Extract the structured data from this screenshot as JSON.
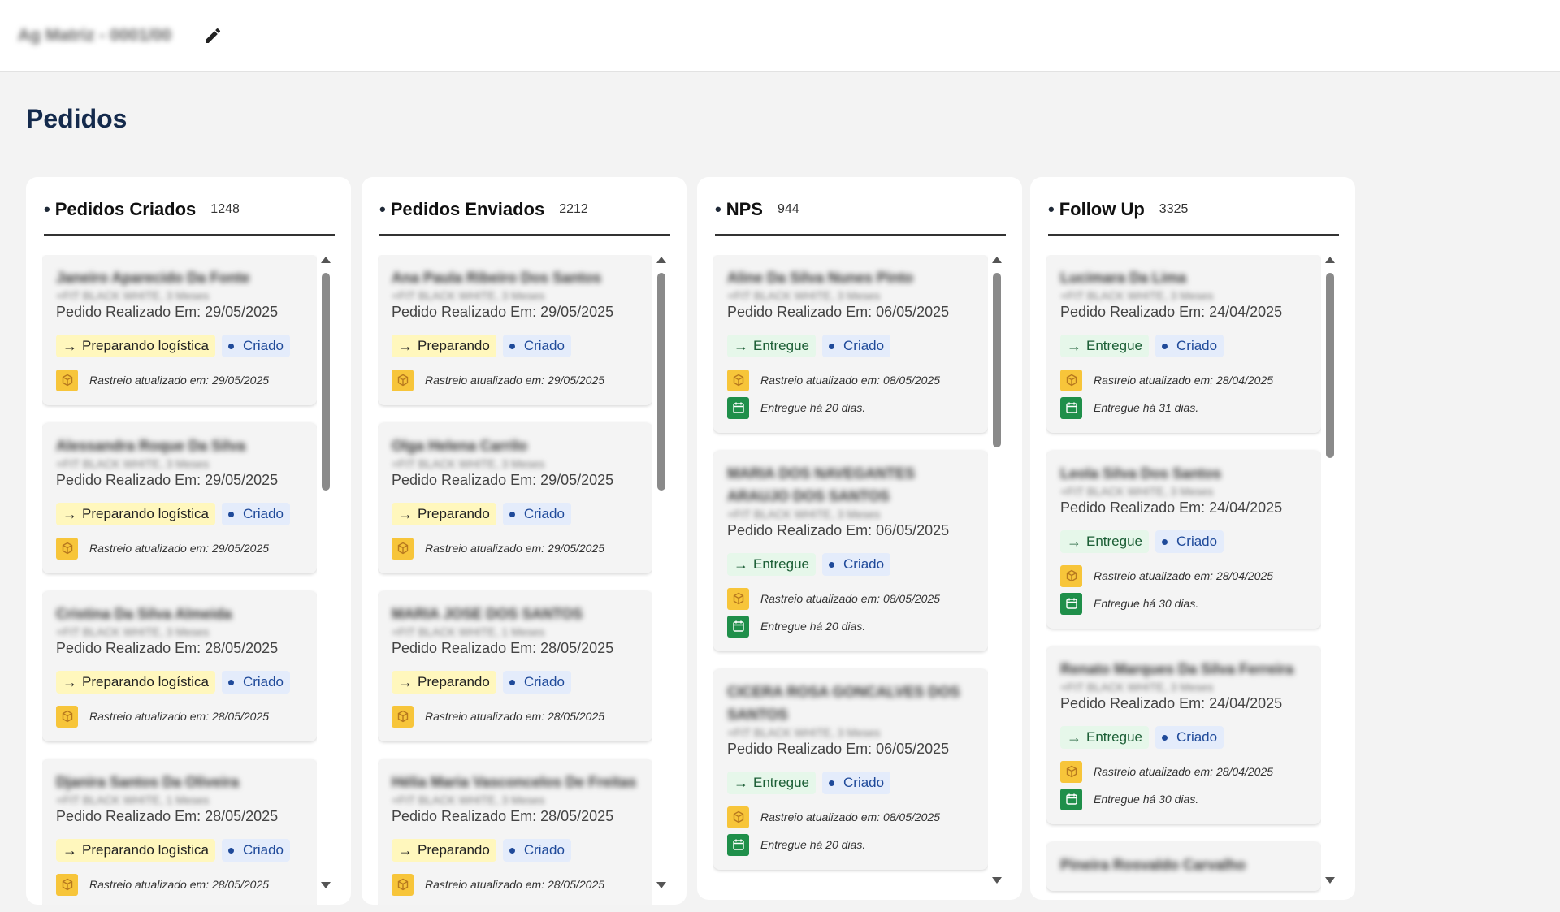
{
  "header": {
    "account_name": "Ag Matriz - 0001/00",
    "edit_icon": "pencil-icon"
  },
  "page": {
    "title": "Pedidos"
  },
  "columns": [
    {
      "title": "Pedidos Criados",
      "count": "1248",
      "cards": [
        {
          "customer": "Janeiro Aparecido Da Fonte",
          "product": "+FIT BLACK WHITE, 3 Meses",
          "date": "Pedido Realizado Em: 29/05/2025",
          "status": "Preparando logística",
          "badge": "Criado",
          "tracking": "Rastreio atualizado em: 29/05/2025"
        },
        {
          "customer": "Alessandra Roque Da Silva",
          "product": "+FIT BLACK WHITE, 3 Meses",
          "date": "Pedido Realizado Em: 29/05/2025",
          "status": "Preparando logística",
          "badge": "Criado",
          "tracking": "Rastreio atualizado em: 29/05/2025"
        },
        {
          "customer": "Cristina Da Silva Almeida",
          "product": "+FIT BLACK WHITE, 3 Meses",
          "date": "Pedido Realizado Em: 28/05/2025",
          "status": "Preparando logística",
          "badge": "Criado",
          "tracking": "Rastreio atualizado em: 28/05/2025"
        },
        {
          "customer": "Djanira Santos Da Oliveira",
          "product": "+FIT BLACK WHITE, 1 Meses",
          "date": "Pedido Realizado Em: 28/05/2025",
          "status": "Preparando logística",
          "badge": "Criado",
          "tracking": "Rastreio atualizado em: 28/05/2025"
        }
      ]
    },
    {
      "title": "Pedidos Enviados",
      "count": "2212",
      "cards": [
        {
          "customer": "Ana Paula Ribeiro Dos Santos",
          "product": "+FIT BLACK WHITE, 3 Meses",
          "date": "Pedido Realizado Em: 29/05/2025",
          "status": "Preparando",
          "badge": "Criado",
          "tracking": "Rastreio atualizado em: 29/05/2025"
        },
        {
          "customer": "Olga Helena Carrilo",
          "product": "+FIT BLACK WHITE, 3 Meses",
          "date": "Pedido Realizado Em: 29/05/2025",
          "status": "Preparando",
          "badge": "Criado",
          "tracking": "Rastreio atualizado em: 29/05/2025"
        },
        {
          "customer": "MARIA JOSE DOS SANTOS",
          "product": "+FIT BLACK WHITE, 1 Meses",
          "date": "Pedido Realizado Em: 28/05/2025",
          "status": "Preparando",
          "badge": "Criado",
          "tracking": "Rastreio atualizado em: 28/05/2025"
        },
        {
          "customer": "Hélia Maria Vasconcelos De Freitas",
          "product": "+FIT BLACK WHITE, 3 Meses",
          "date": "Pedido Realizado Em: 28/05/2025",
          "status": "Preparando",
          "badge": "Criado",
          "tracking": "Rastreio atualizado em: 28/05/2025"
        }
      ]
    },
    {
      "title": "NPS",
      "count": "944",
      "cards": [
        {
          "customer": "Aline Da Silva Nunes Pinto",
          "product": "+FIT BLACK WHITE, 3 Meses",
          "date": "Pedido Realizado Em: 06/05/2025",
          "status": "Entregue",
          "badge": "Criado",
          "tracking": "Rastreio atualizado em: 08/05/2025",
          "delivered": "Entregue há 20 dias."
        },
        {
          "customer": "MARIA DOS NAVEGANTES ARAUJO DOS SANTOS",
          "product": "+FIT BLACK WHITE, 3 Meses",
          "date": "Pedido Realizado Em: 06/05/2025",
          "status": "Entregue",
          "badge": "Criado",
          "tracking": "Rastreio atualizado em: 08/05/2025",
          "delivered": "Entregue há 20 dias."
        },
        {
          "customer": "CICERA ROSA GONCALVES DOS SANTOS",
          "product": "+FIT BLACK WHITE, 3 Meses",
          "date": "Pedido Realizado Em: 06/05/2025",
          "status": "Entregue",
          "badge": "Criado",
          "tracking": "Rastreio atualizado em: 08/05/2025",
          "delivered": "Entregue há 20 dias."
        }
      ]
    },
    {
      "title": "Follow Up",
      "count": "3325",
      "cards": [
        {
          "customer": "Lucimara Da Lima",
          "product": "+FIT BLACK WHITE, 3 Meses",
          "date": "Pedido Realizado Em: 24/04/2025",
          "status": "Entregue",
          "badge": "Criado",
          "tracking": "Rastreio atualizado em: 28/04/2025",
          "delivered": "Entregue há 31 dias."
        },
        {
          "customer": "Leola Silva Dos Santos",
          "product": "+FIT BLACK WHITE, 3 Meses",
          "date": "Pedido Realizado Em: 24/04/2025",
          "status": "Entregue",
          "badge": "Criado",
          "tracking": "Rastreio atualizado em: 28/04/2025",
          "delivered": "Entregue há 30 dias."
        },
        {
          "customer": "Renato Marques Da Silva Ferreira",
          "product": "+FIT BLACK WHITE, 3 Meses",
          "date": "Pedido Realizado Em: 24/04/2025",
          "status": "Entregue",
          "badge": "Criado",
          "tracking": "Rastreio atualizado em: 28/04/2025",
          "delivered": "Entregue há 30 dias."
        },
        {
          "customer": "Pineira Rosvaldo Carvalho",
          "product": "",
          "date": "",
          "status": "",
          "badge": "",
          "tracking": ""
        }
      ]
    }
  ]
}
